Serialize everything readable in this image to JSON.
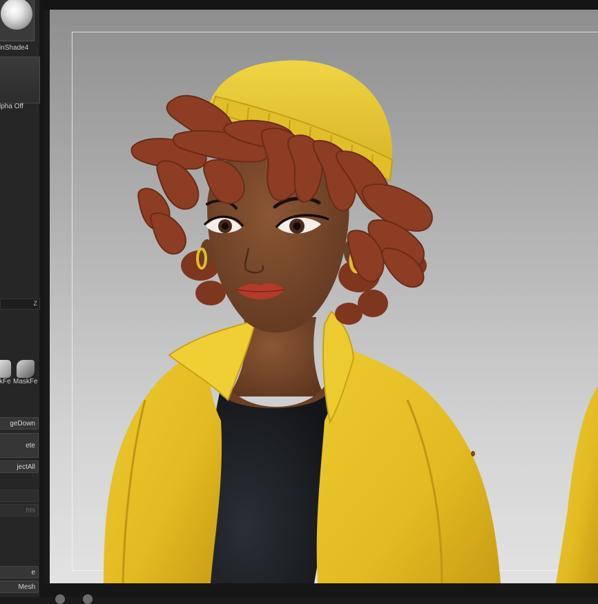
{
  "tray": {
    "material_label": "inShade4",
    "alpha_label": "lpha Off",
    "slider_letter": "Z",
    "mask_label_left": "kFe",
    "mask_label_right": "MaskFe",
    "buttons": {
      "merge_down": "geDown",
      "delete": "ete",
      "project_all": "jectAll",
      "lights": "hts",
      "bottom_one": "e",
      "bottom_mesh": "Mesh"
    }
  },
  "viewport": {
    "subject": "stylized-character-bust",
    "colors": {
      "background_top": "#8e8e8e",
      "background_bottom": "#e2e2e2",
      "jacket": "#e6c027",
      "beanie": "#e8c92f",
      "hair": "#8d3d24",
      "skin": "#7a4a2e",
      "shirt": "#1c1e22",
      "lips": "#b43a2a"
    }
  }
}
